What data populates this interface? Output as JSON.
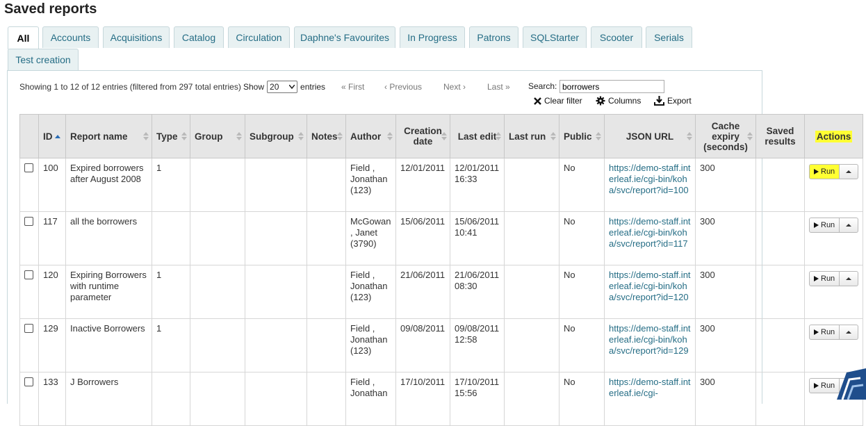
{
  "page": {
    "title": "Saved reports"
  },
  "tabs": [
    "All",
    "Accounts",
    "Acquisitions",
    "Catalog",
    "Circulation",
    "Daphne's Favourites",
    "In Progress",
    "Patrons",
    "SQLStarter",
    "Scooter",
    "Serials",
    "Test creation"
  ],
  "active_tab": "All",
  "toolbar": {
    "info": "Showing 1 to 12 of 12 entries (filtered from 297 total entries)",
    "show_label": "Show",
    "show_value": "20",
    "entries_label": "entries",
    "first": "« First",
    "previous": "‹ Previous",
    "next": "Next ›",
    "last": "Last »",
    "search_label": "Search:",
    "search_value": "borrowers",
    "clear_filter": "Clear filter",
    "columns": "Columns",
    "export": "Export"
  },
  "table": {
    "headers": {
      "id": "ID",
      "report_name": "Report name",
      "type": "Type",
      "group": "Group",
      "subgroup": "Subgroup",
      "notes": "Notes",
      "author": "Author",
      "creation_date": "Creation date",
      "last_edit": "Last edit",
      "last_run": "Last run",
      "public": "Public",
      "json_url": "JSON URL",
      "cache_expiry": "Cache expiry (seconds)",
      "saved_results": "Saved results",
      "actions": "Actions"
    },
    "run_label": "Run",
    "rows": [
      {
        "id": "100",
        "name": "Expired borrowers after August 2008",
        "type": "1",
        "group": "",
        "subgroup": "",
        "notes": "",
        "author": "Field , Jonathan (123)",
        "created": "12/01/2011",
        "edited": "12/01/2011 16:33",
        "last_run": "",
        "public": "No",
        "json": "https://demo-staff.interleaf.ie/cgi-bin/koha/svc/report?id=100",
        "cache": "300",
        "saved": ""
      },
      {
        "id": "117",
        "name": "all the borrowers",
        "type": "",
        "group": "",
        "subgroup": "",
        "notes": "",
        "author": "McGowan , Janet (3790)",
        "created": "15/06/2011",
        "edited": "15/06/2011 10:41",
        "last_run": "",
        "public": "No",
        "json": "https://demo-staff.interleaf.ie/cgi-bin/koha/svc/report?id=117",
        "cache": "300",
        "saved": ""
      },
      {
        "id": "120",
        "name": "Expiring Borrowers with runtime parameter",
        "type": "1",
        "group": "",
        "subgroup": "",
        "notes": "",
        "author": "Field , Jonathan (123)",
        "created": "21/06/2011",
        "edited": "21/06/2011 08:30",
        "last_run": "",
        "public": "No",
        "json": "https://demo-staff.interleaf.ie/cgi-bin/koha/svc/report?id=120",
        "cache": "300",
        "saved": ""
      },
      {
        "id": "129",
        "name": "Inactive Borrowers",
        "type": "1",
        "group": "",
        "subgroup": "",
        "notes": "",
        "author": "Field , Jonathan (123)",
        "created": "09/08/2011",
        "edited": "09/08/2011 12:58",
        "last_run": "",
        "public": "No",
        "json": "https://demo-staff.interleaf.ie/cgi-bin/koha/svc/report?id=129",
        "cache": "300",
        "saved": ""
      },
      {
        "id": "133",
        "name": "J Borrowers",
        "type": "",
        "group": "",
        "subgroup": "",
        "notes": "",
        "author": "Field , Jonathan",
        "created": "17/10/2011",
        "edited": "17/10/2011 15:56",
        "last_run": "",
        "public": "No",
        "json": "https://demo-staff.interleaf.ie/cgi-",
        "cache": "300",
        "saved": ""
      }
    ]
  },
  "colors": {
    "link": "#256d85",
    "tab_bg": "#e8f1f2",
    "highlight": "#ffff33",
    "header_bg": "#e6e6e6"
  }
}
